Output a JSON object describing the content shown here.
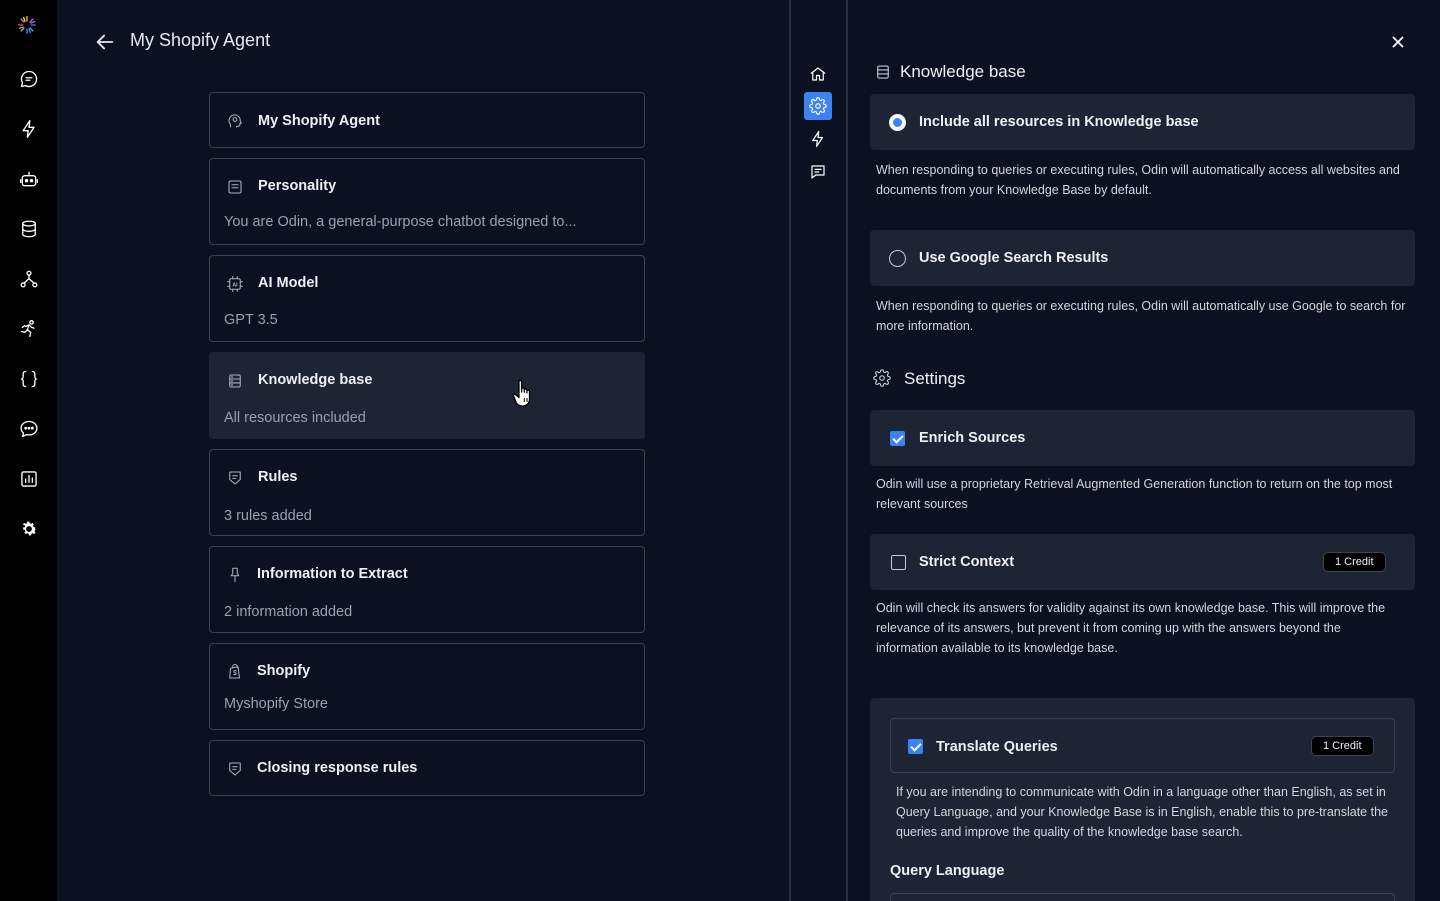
{
  "nav": {
    "items": [
      "logo-icon",
      "chat-icon",
      "lightning-icon",
      "bot-icon",
      "database-icon",
      "hierarchy-icon",
      "run-icon",
      "code-braces-icon",
      "message-dots-icon",
      "chart-icon",
      "settings-icon"
    ]
  },
  "header": {
    "title": "My Shopify Agent"
  },
  "cards": [
    {
      "id": "name",
      "title": "My Shopify Agent",
      "subtitle": "",
      "icon": "head-icon"
    },
    {
      "id": "personality",
      "title": "Personality",
      "subtitle": "You are Odin, a general-purpose chatbot designed to...",
      "icon": "document-icon"
    },
    {
      "id": "ai-model",
      "title": "AI Model",
      "subtitle": "GPT 3.5",
      "icon": "ai-chip-icon"
    },
    {
      "id": "knowledge-base",
      "title": "Knowledge base",
      "subtitle": "All resources included",
      "icon": "database-icon",
      "active": true
    },
    {
      "id": "rules",
      "title": "Rules",
      "subtitle": "3 rules added",
      "icon": "shield-list-icon"
    },
    {
      "id": "extract",
      "title": "Information to Extract",
      "subtitle": "2 information added",
      "icon": "pin-icon"
    },
    {
      "id": "shopify",
      "title": "Shopify",
      "subtitle": "Myshopify Store",
      "icon": "shopify-bag-icon"
    },
    {
      "id": "closing",
      "title": "Closing response rules",
      "subtitle": "",
      "icon": "shield-list-icon"
    }
  ],
  "mini_tabs": [
    "home-icon",
    "gear-icon",
    "lightning-icon",
    "message-icon"
  ],
  "panel": {
    "title": "Knowledge base",
    "options": [
      {
        "label": "Include all resources in Knowledge base",
        "selected": true,
        "description": "When responding to queries or executing rules, Odin will automatically access all websites and documents from your Knowledge Base by default."
      },
      {
        "label": "Use Google Search Results",
        "selected": false,
        "description": "When responding to queries or executing rules, Odin will automatically use Google to search for more information."
      }
    ],
    "settings": {
      "title": "Settings",
      "enrich": {
        "label": "Enrich Sources",
        "checked": true,
        "description": "Odin will use a proprietary Retrieval Augmented Generation function to return on the top most relevant sources"
      },
      "strict": {
        "label": "Strict Context",
        "checked": false,
        "badge": "1 Credit",
        "description": "Odin will check its answers for validity against its own knowledge base. This will improve the relevance of its answers, but prevent it from coming up with the answers beyond the information available to its knowledge base."
      },
      "translate": {
        "label": "Translate Queries",
        "checked": true,
        "badge": "1 Credit",
        "description": "If you are intending to communicate with Odin in a language other than English, as set in Query Language, and your Knowledge Base is in English, enable this to pre-translate the queries and improve the quality of the knowledge base search."
      },
      "query_language": {
        "label": "Query Language"
      }
    }
  },
  "colors": {
    "accent": "#3b82f6",
    "background": "#0b1120",
    "surface": "#1d2433",
    "rail": "#000000"
  }
}
